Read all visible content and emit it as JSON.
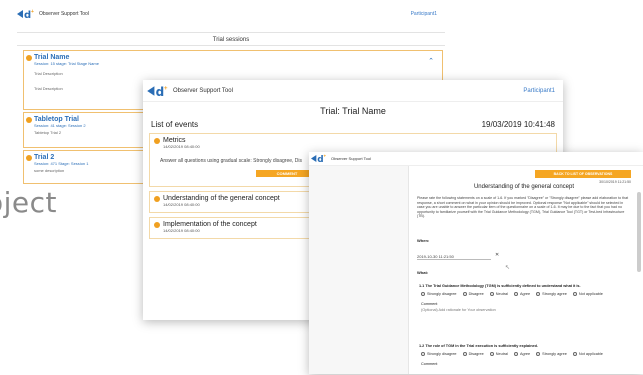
{
  "background_text": "oject",
  "app": {
    "title": "Observer Support Tool",
    "participant": "Participant1"
  },
  "window1": {
    "header_title": "Trial sessions",
    "sessions": [
      {
        "name": "Trial Name",
        "meta": "Session: 15 stage: Trial Stage Name",
        "desc": "Trial Description",
        "desc2": "Trial Description"
      },
      {
        "name": "Tabletop Trial",
        "meta": "Session: 41 stage: Session 2",
        "desc": "Tabletop Trial 2"
      },
      {
        "name": "Trial 2",
        "meta": "Session: 471 Stage: Session 1",
        "desc": "some description"
      }
    ]
  },
  "window2": {
    "title": "Trial: Trial Name",
    "list_label": "List of events",
    "datetime": "19/03/2019 10:41:48",
    "events": [
      {
        "name": "Metrics",
        "date": "14/02/2019 08:40:00",
        "instruction": "Answer all questions using gradual scale: Strongly disagree, Dis",
        "button": "COMMENT"
      },
      {
        "name": "Understanding of the general concept",
        "date": "14/02/2019 08:40:00"
      },
      {
        "name": "Implementation of the concept",
        "date": "14/02/2019 08:40:00"
      }
    ]
  },
  "window3": {
    "back_button": "BACK TO LIST OF OBSERVATIONS",
    "date": "30/10/2019 11:21:50",
    "heading": "Understanding of the general concept",
    "paragraph": "Please rate the following statements on a scale of 1-6. If you marked \"Disagree\" or \"Strongly disagree\" please add elaboration to that response, a short comment on what in your opinion should be improved. Optional response \"Not applicable\" should be selected in case you are unable to answer the particular item of the questionnaire on a scale of 1-6. It may be due to the fact that you had no opportunity to familiarize yourself with the Trial Guidance Methodology (TGM), Trial Guidance Tool (TGT) or Test-bed Infrastructure (TB).",
    "when_label": "When:",
    "when_value": "2019-10-30 11:21:50",
    "what_label": "What:",
    "questions": [
      {
        "text": "1.1 The Trial Guidance Methodology (TGM) is sufficiently defined to understand what it is.",
        "comment_label": "Comment",
        "comment_placeholder": "(Optional) Add rationale for Your observation"
      },
      {
        "text": "1.2 The role of TGM in the Trial execution is sufficiently explained.",
        "comment_label": "Comment"
      }
    ],
    "options": [
      "Strongly disagree",
      "Disagree",
      "Neutral",
      "Agree",
      "Strongly agree",
      "Not applicable"
    ]
  }
}
